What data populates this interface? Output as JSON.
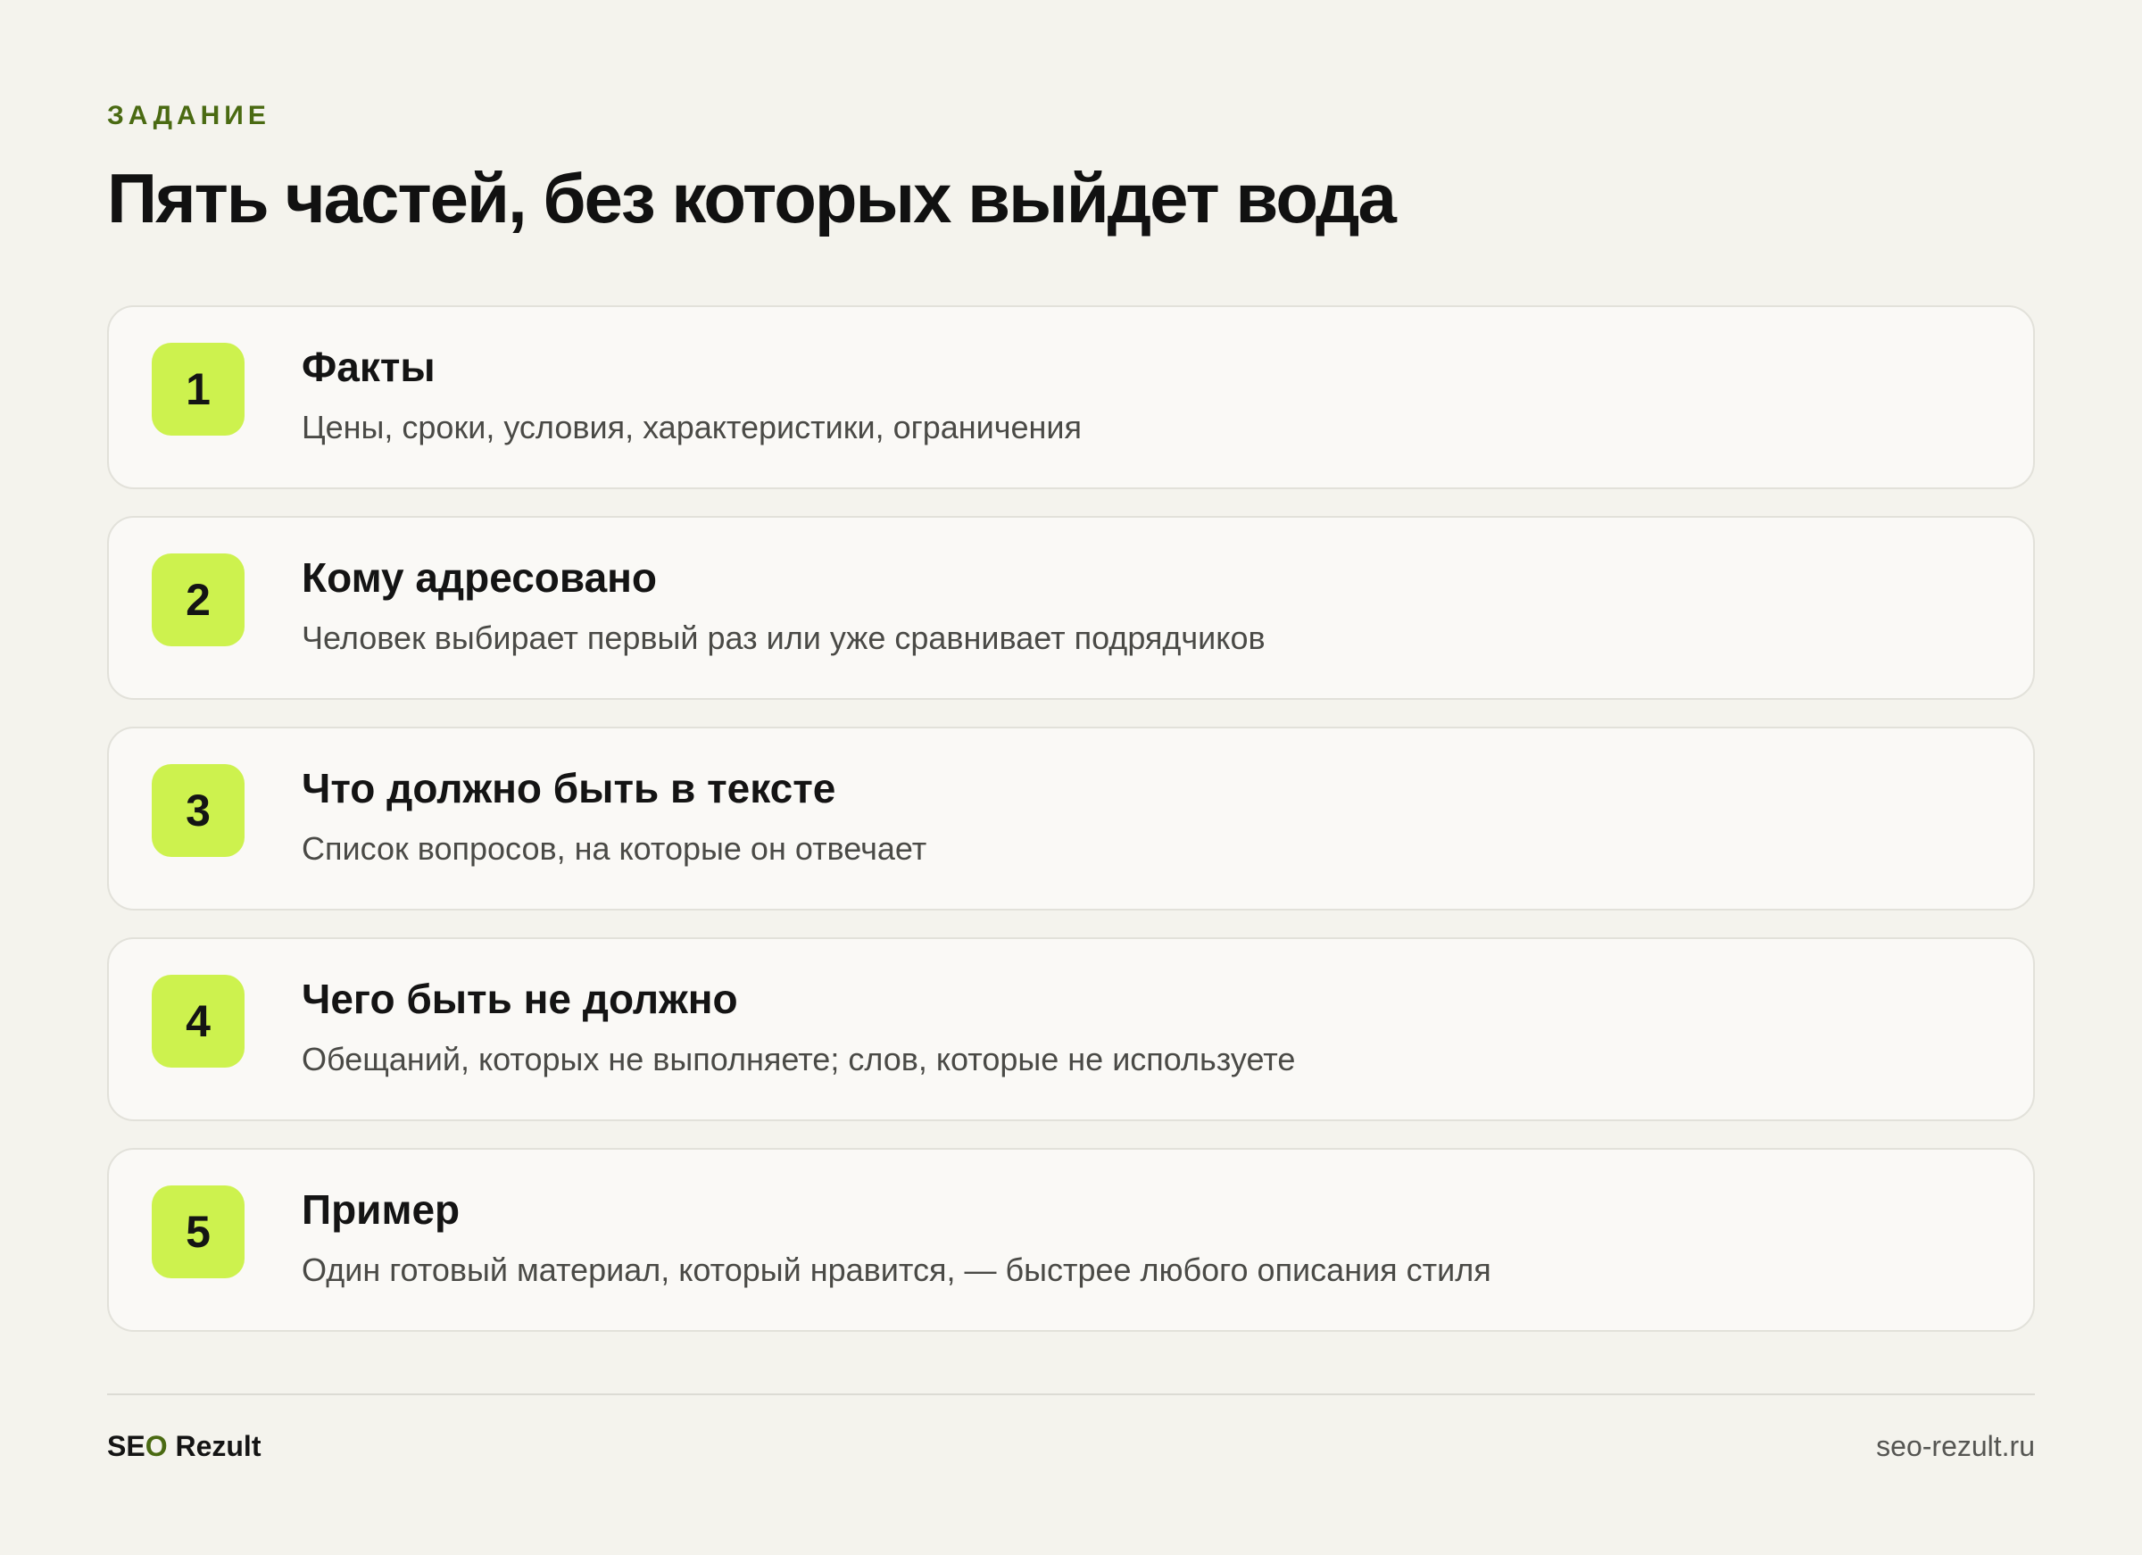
{
  "eyebrow": "ЗАДАНИЕ",
  "title": "Пять частей, без которых выйдет вода",
  "colors": {
    "background": "#f4f3ed",
    "card": "#faf9f6",
    "badge": "#cdf24e",
    "accent": "#4a6a12"
  },
  "items": [
    {
      "number": "1",
      "title": "Факты",
      "description": "Цены, сроки, условия, характеристики, ограничения"
    },
    {
      "number": "2",
      "title": "Кому адресовано",
      "description": "Человек выбирает первый раз или уже сравнивает подрядчиков"
    },
    {
      "number": "3",
      "title": "Что должно быть в тексте",
      "description": "Список вопросов, на которые он отвечает"
    },
    {
      "number": "4",
      "title": "Чего быть не должно",
      "description": "Обещаний, которых не выполняете; слов, которые не используете"
    },
    {
      "number": "5",
      "title": "Пример",
      "description": "Один готовый материал, который нравится, — быстрее любого описания стиля"
    }
  ],
  "footer": {
    "brand_part1": "SE",
    "brand_accent": "O",
    "brand_part2": " Rezult",
    "site": "seo-rezult.ru"
  }
}
